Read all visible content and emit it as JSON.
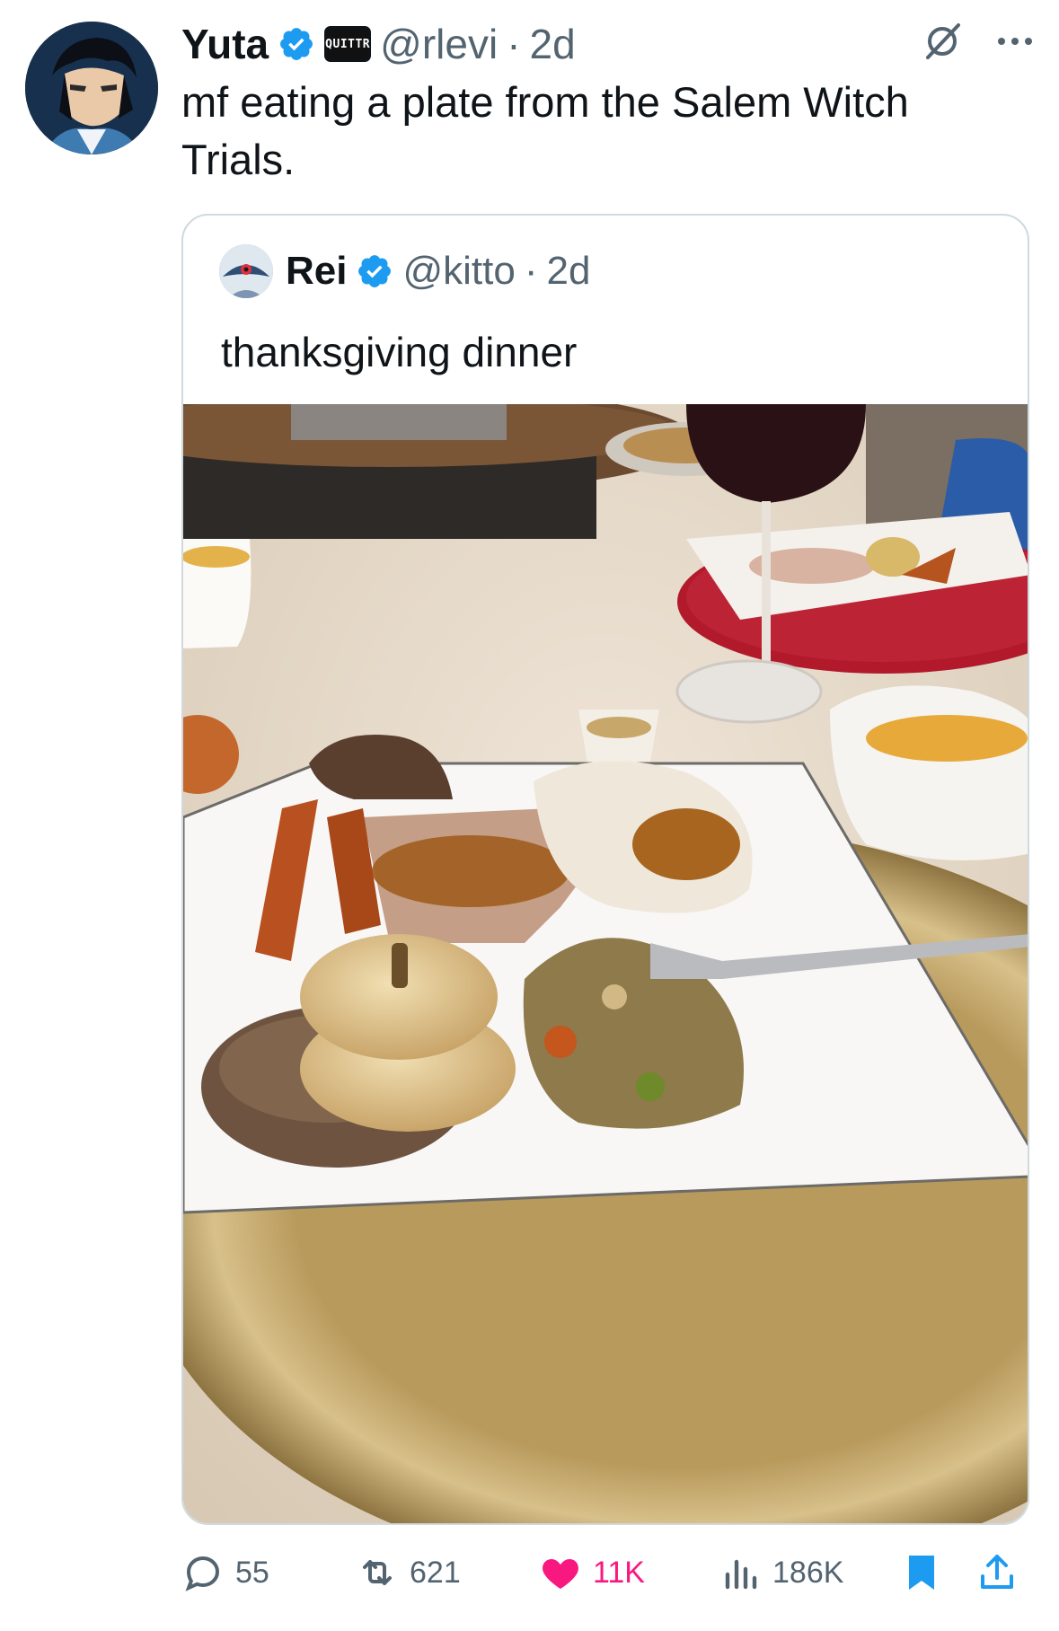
{
  "post": {
    "author_name": "Yuta",
    "affiliate_badge": "QUITTR",
    "handle": "@rlevi",
    "separator": "·",
    "time": "2d",
    "text": "mf eating a plate from the Salem Witch Trials."
  },
  "quoted": {
    "author_name": "Rei",
    "handle": "@kitto",
    "separator": "·",
    "time": "2d",
    "text": "thanksgiving dinner"
  },
  "actions": {
    "replies": "55",
    "reposts": "621",
    "likes": "11K",
    "views": "186K"
  },
  "colors": {
    "verified": "#1d9bf0",
    "like": "#f91880",
    "bookmark": "#1d9bf0",
    "muted": "#536471"
  },
  "icons": [
    "verified-icon",
    "grok-icon",
    "more-icon",
    "reply-icon",
    "repost-icon",
    "heart-icon",
    "views-icon",
    "bookmark-icon",
    "share-icon"
  ]
}
